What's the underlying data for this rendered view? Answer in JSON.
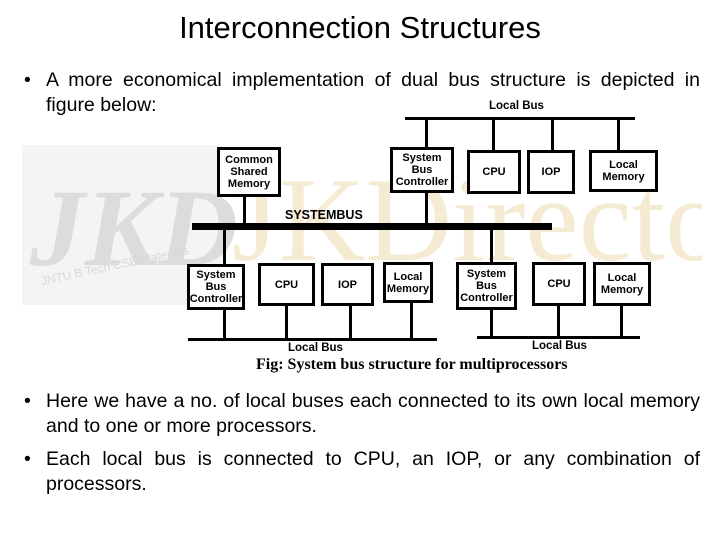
{
  "title": "Interconnection Structures",
  "bullets": [
    "A more economical implementation of dual bus structure is depicted in figure below:",
    "Here we have a no. of local buses each connected to its own local memory and to one or more processors.",
    "Each local bus is connected to CPU, an IOP, or any combination of processors."
  ],
  "bullet_symbol": "•",
  "watermark": {
    "logo": "JKD",
    "brand": "JKDirectory!",
    "sub": "JNTU B Tech CSE Materials"
  },
  "diagram": {
    "top_local_bus": "Local Bus",
    "system_bus": "SYSTEMBUS",
    "common_memory": "Common Shared Memory",
    "top_units": [
      "System Bus Controller",
      "CPU",
      "IOP",
      "Local Memory"
    ],
    "bottom_left_units": [
      "System Bus Controller",
      "CPU",
      "IOP",
      "Local Memory"
    ],
    "bottom_left_bus": "Local Bus",
    "bottom_right_units": [
      "System Bus Controller",
      "CPU",
      "Local Memory"
    ],
    "bottom_right_bus": "Local Bus",
    "caption": "Fig: System bus structure for multiprocessors"
  }
}
